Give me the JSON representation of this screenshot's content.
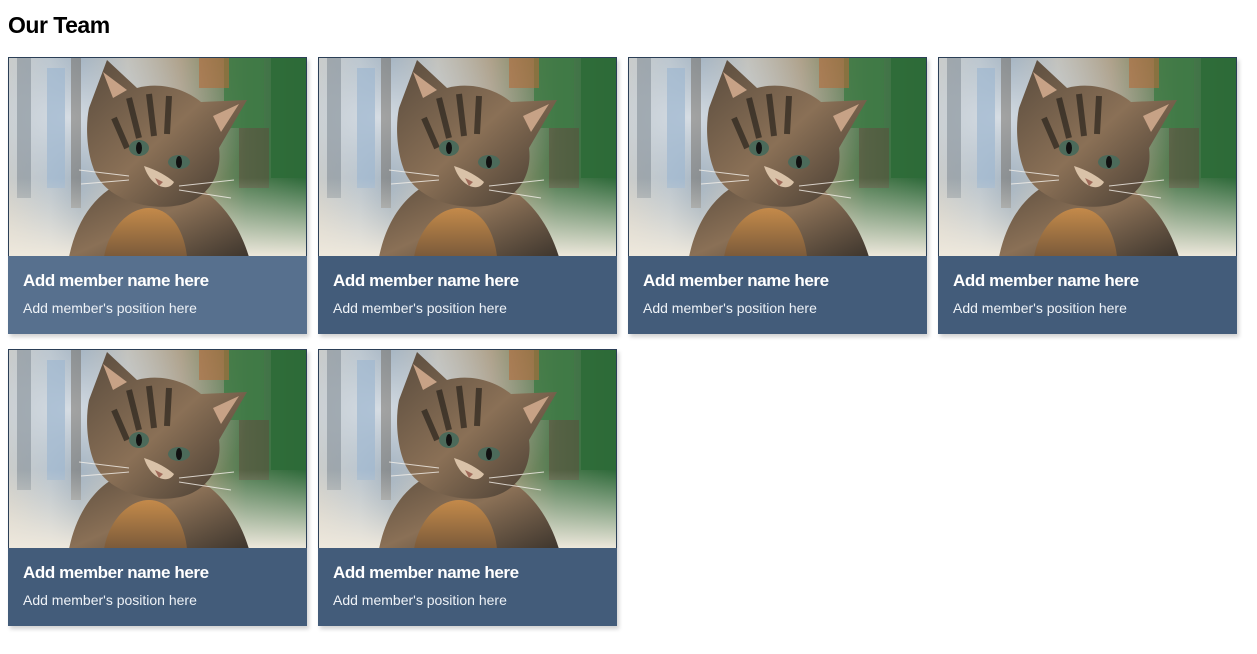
{
  "page": {
    "title": "Our Team"
  },
  "colors": {
    "card_background": "#435c7a",
    "card_background_hover": "#57708e",
    "text": "#ffffff"
  },
  "members": [
    {
      "photo_icon": "kitten-photo",
      "name": "Add member name here",
      "position": "Add member's position here",
      "state": "hover"
    },
    {
      "photo_icon": "kitten-photo",
      "name": "Add member name here",
      "position": "Add member's position here",
      "state": "normal"
    },
    {
      "photo_icon": "kitten-photo",
      "name": "Add member name here",
      "position": "Add member's position here",
      "state": "normal"
    },
    {
      "photo_icon": "kitten-photo",
      "name": "Add member name here",
      "position": "Add member's position here",
      "state": "normal"
    },
    {
      "photo_icon": "kitten-photo",
      "name": "Add member name here",
      "position": "Add member's position here",
      "state": "normal"
    },
    {
      "photo_icon": "kitten-photo",
      "name": "Add member name here",
      "position": "Add member's position here",
      "state": "normal"
    }
  ]
}
